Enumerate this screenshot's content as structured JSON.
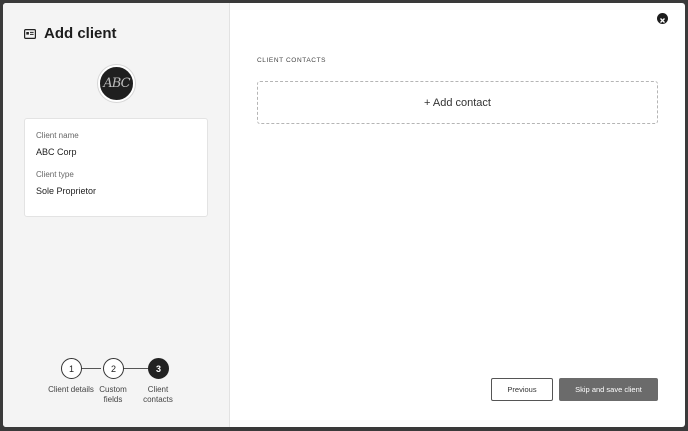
{
  "dialog": {
    "title": "Add client",
    "title_icon": "id-card-icon",
    "close_icon": "close-icon"
  },
  "avatar": {
    "initials": "ABC"
  },
  "client_card": {
    "name_label": "Client name",
    "name_value": "ABC Corp",
    "type_label": "Client type",
    "type_value": "Sole Proprietor"
  },
  "stepper": {
    "steps": [
      {
        "number": "1",
        "label": "Client details"
      },
      {
        "number": "2",
        "label": "Custom fields"
      },
      {
        "number": "3",
        "label": "Client contacts"
      }
    ],
    "active_step": 3
  },
  "contacts": {
    "section_title": "CLIENT CONTACTS",
    "add_label": "+ Add contact"
  },
  "footer": {
    "previous_label": "Previous",
    "skip_label": "Skip and save client"
  },
  "colors": {
    "left_panel_bg": "#f4f4f4",
    "primary_button_bg": "#6b6b6b",
    "active_step_bg": "#222222"
  }
}
